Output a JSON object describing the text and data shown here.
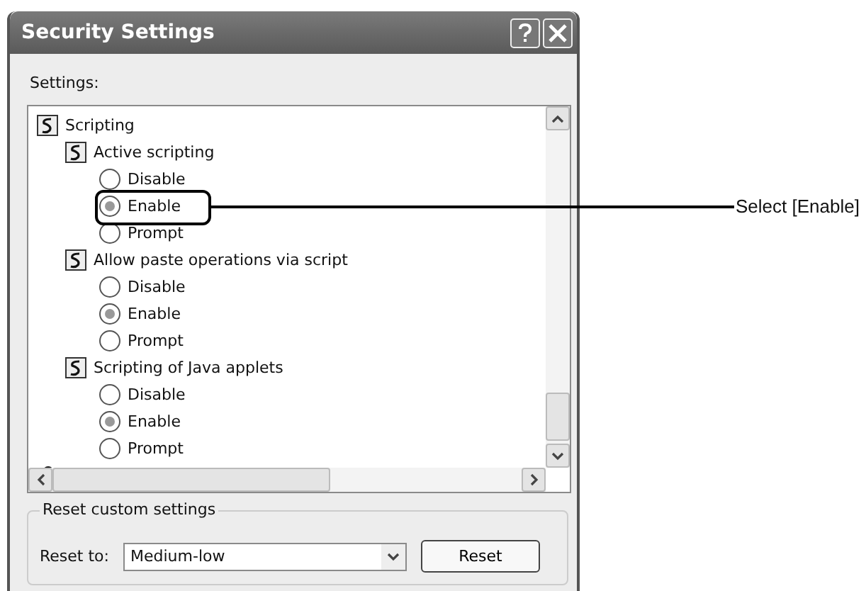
{
  "window": {
    "title": "Security Settings"
  },
  "settings": {
    "label": "Settings:",
    "tree": [
      {
        "name": "Scripting",
        "children": [
          {
            "name": "Active scripting",
            "options": [
              {
                "label": "Disable",
                "selected": false
              },
              {
                "label": "Enable",
                "selected": true
              },
              {
                "label": "Prompt",
                "selected": false
              }
            ]
          },
          {
            "name": "Allow paste operations via script",
            "options": [
              {
                "label": "Disable",
                "selected": false
              },
              {
                "label": "Enable",
                "selected": true
              },
              {
                "label": "Prompt",
                "selected": false
              }
            ]
          },
          {
            "name": "Scripting of Java applets",
            "options": [
              {
                "label": "Disable",
                "selected": false
              },
              {
                "label": "Enable",
                "selected": true
              },
              {
                "label": "Prompt",
                "selected": false
              }
            ]
          }
        ]
      }
    ]
  },
  "reset": {
    "title": "Reset custom settings",
    "label": "Reset to:",
    "value": "Medium-low",
    "button": "Reset"
  },
  "callout": {
    "text": "Select [Enable]"
  }
}
